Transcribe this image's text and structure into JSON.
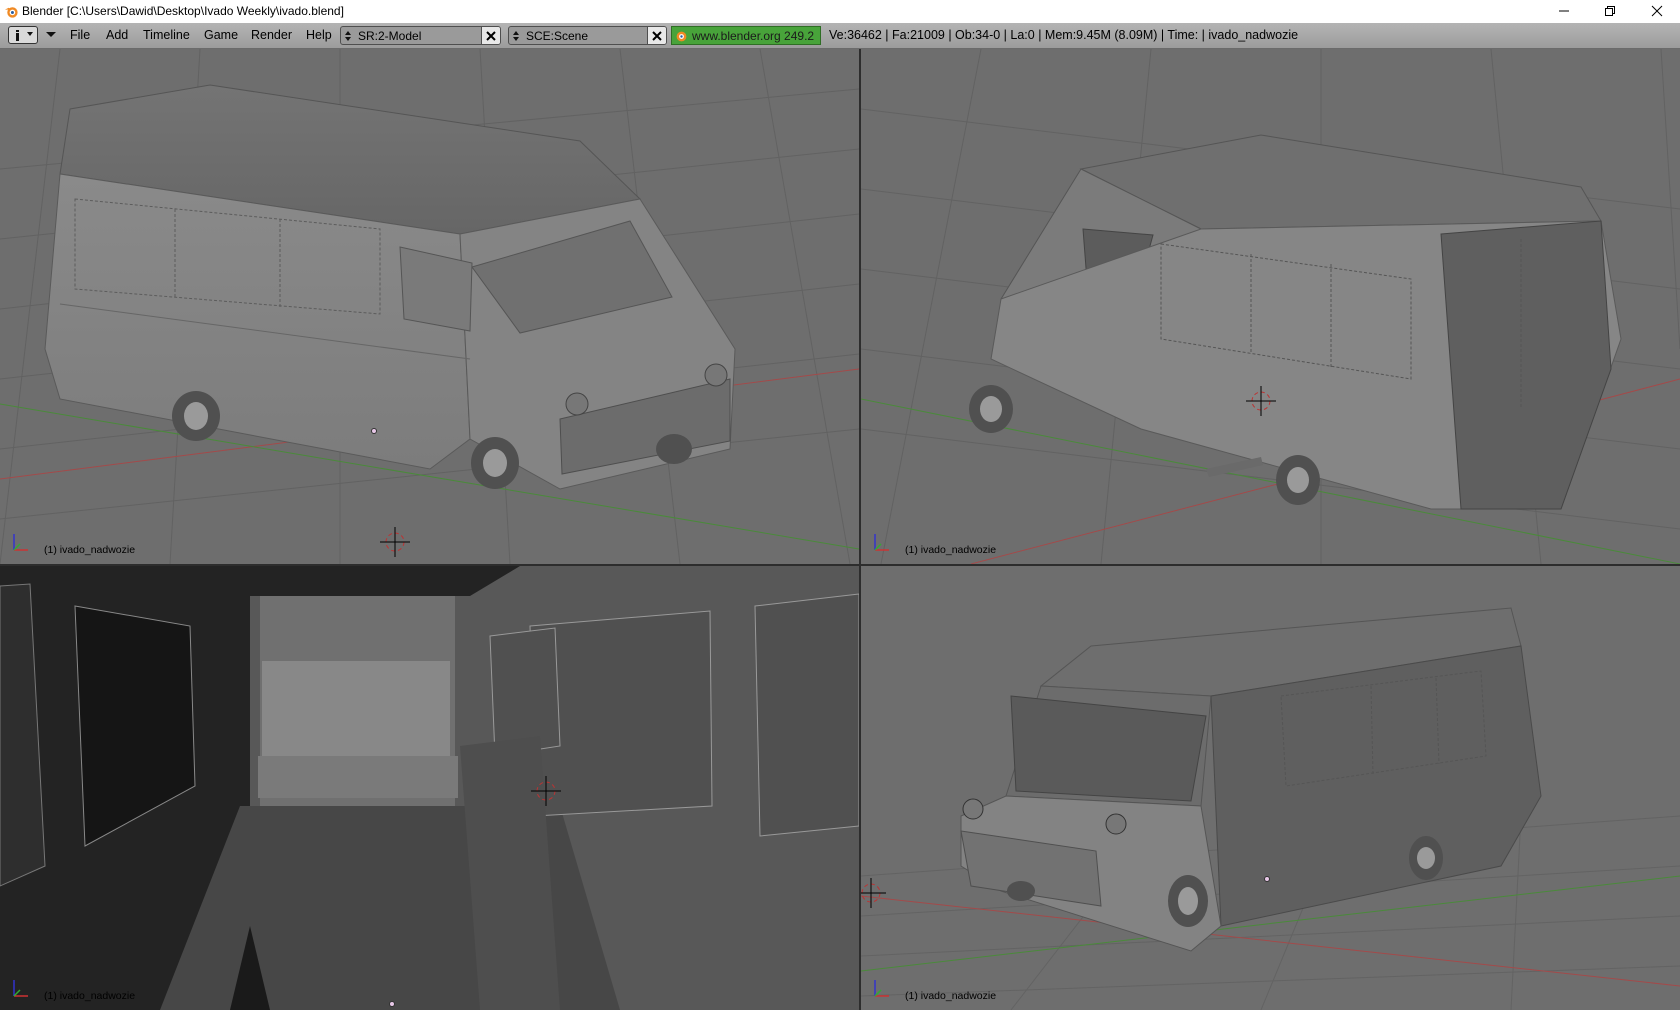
{
  "window": {
    "title": "Blender [C:\\Users\\Dawid\\Desktop\\Ivado Weekly\\ivado.blend]",
    "controls": [
      "minimize-icon",
      "restore-icon",
      "close-icon"
    ]
  },
  "header": {
    "menus": [
      "File",
      "Add",
      "Timeline",
      "Game",
      "Render",
      "Help"
    ],
    "screen_field": "SR:2-Model",
    "scene_field": "SCE:Scene",
    "website": "www.blender.org 249.2",
    "stats": "Ve:36462 | Fa:21009 | Ob:34-0 | La:0   | Mem:9.45M (8.09M)   | Time: | ivado_nadwozie"
  },
  "viewports": [
    {
      "name": "top-left",
      "label": "(1) ivado_nadwozie"
    },
    {
      "name": "top-right",
      "label": "(1) ivado_nadwozie"
    },
    {
      "name": "bottom-left",
      "label": "(1) ivado_nadwozie"
    },
    {
      "name": "bottom-right",
      "label": "(1) ivado_nadwozie"
    }
  ],
  "colors": {
    "viewport_bg": "#6e6e6e",
    "grid": "#5f5f5f",
    "x_axis": "#a34a4a",
    "y_axis": "#4a8a3a",
    "header": "#a8a8a8",
    "website_bg": "#48a33a"
  }
}
